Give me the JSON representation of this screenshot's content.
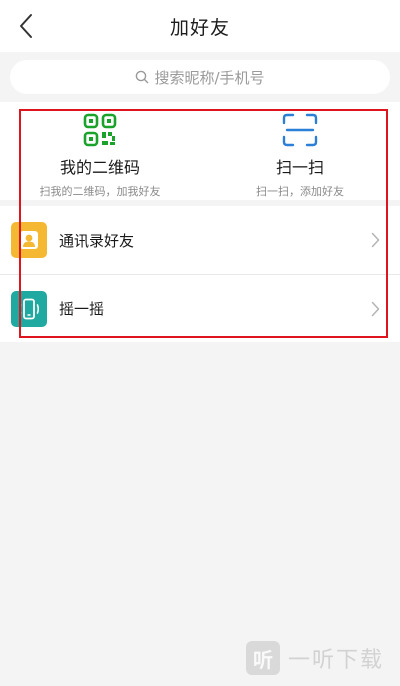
{
  "nav": {
    "title": "加好友",
    "back_icon": "chevron-left-icon"
  },
  "search": {
    "placeholder": "搜索昵称/手机号",
    "icon": "search-icon"
  },
  "quick_actions": [
    {
      "title": "我的二维码",
      "subtitle": "扫我的二维码，加我好友",
      "icon": "qr-code-icon",
      "color": "#1aa32a"
    },
    {
      "title": "扫一扫",
      "subtitle": "扫一扫，添加好友",
      "icon": "scan-icon",
      "color": "#2b7fd6"
    }
  ],
  "list_items": [
    {
      "label": "通讯录好友",
      "icon": "contacts-icon",
      "color": "#f5b833"
    },
    {
      "label": "摇一摇",
      "icon": "phone-shake-icon",
      "color": "#1fa9a0"
    }
  ],
  "watermark": {
    "text": "一听下载",
    "logo_text": "听"
  },
  "colors": {
    "highlight": "#e0141e",
    "background": "#f4f4f5"
  }
}
